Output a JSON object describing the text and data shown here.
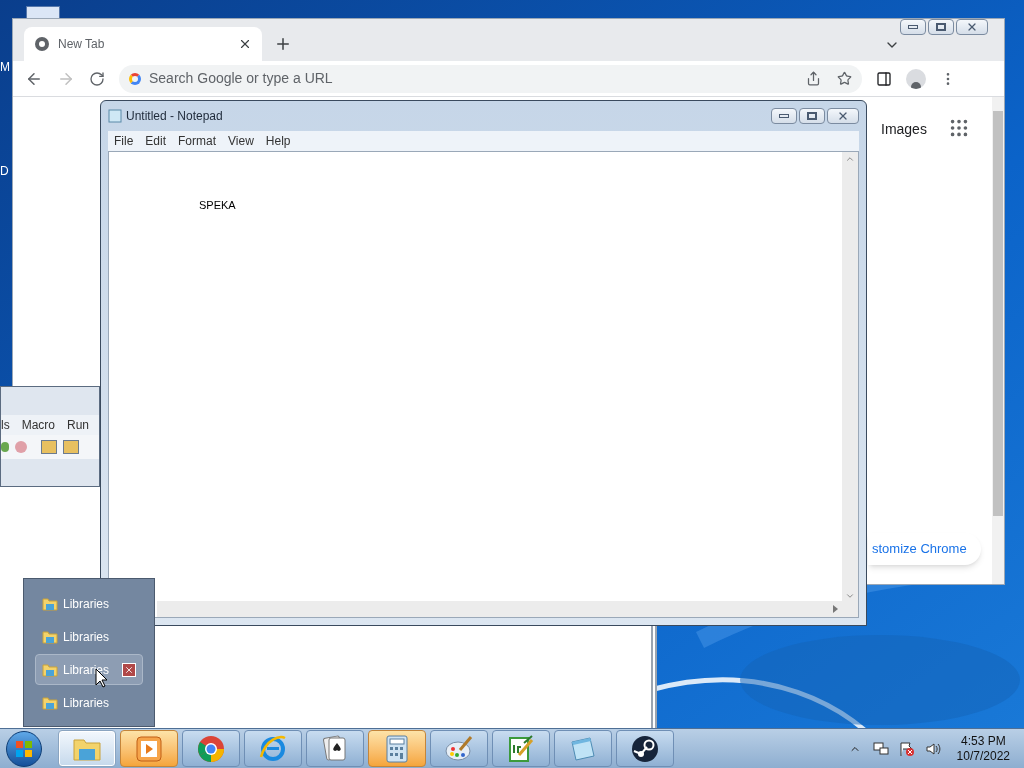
{
  "desktop": {
    "icon_labels": [
      "M",
      "D"
    ]
  },
  "browser": {
    "tabs": [
      {
        "title": "New Tab",
        "selected": true
      }
    ],
    "address_placeholder": "Search Google or type a URL",
    "links": [
      "Images"
    ],
    "customize_button": "stomize Chrome"
  },
  "macro_window": {
    "menu": [
      "ls",
      "Macro",
      "Run"
    ]
  },
  "notepad": {
    "title": "Untitled - Notepad",
    "menu": [
      "File",
      "Edit",
      "Format",
      "View",
      "Help"
    ],
    "text": "SPEKA"
  },
  "jump_list": {
    "items": [
      {
        "label": "Libraries",
        "selected": false
      },
      {
        "label": "Libraries",
        "selected": false
      },
      {
        "label": "Libraries",
        "selected": true
      },
      {
        "label": "Libraries",
        "selected": false
      }
    ]
  },
  "taskbar": {
    "buttons": [
      {
        "kind": "explorer",
        "hovered": true,
        "flashing": false
      },
      {
        "kind": "media",
        "hovered": false,
        "flashing": true
      },
      {
        "kind": "chrome",
        "hovered": false,
        "flashing": false
      },
      {
        "kind": "ie",
        "hovered": false,
        "flashing": false
      },
      {
        "kind": "cards",
        "hovered": false,
        "flashing": false
      },
      {
        "kind": "calculator",
        "hovered": false,
        "flashing": true
      },
      {
        "kind": "paint",
        "hovered": false,
        "flashing": false
      },
      {
        "kind": "notepadpp",
        "hovered": false,
        "flashing": false
      },
      {
        "kind": "notepad",
        "hovered": false,
        "flashing": false
      },
      {
        "kind": "steam",
        "hovered": false,
        "flashing": false
      }
    ],
    "clock": {
      "time": "4:53 PM",
      "date": "10/7/2022"
    }
  }
}
